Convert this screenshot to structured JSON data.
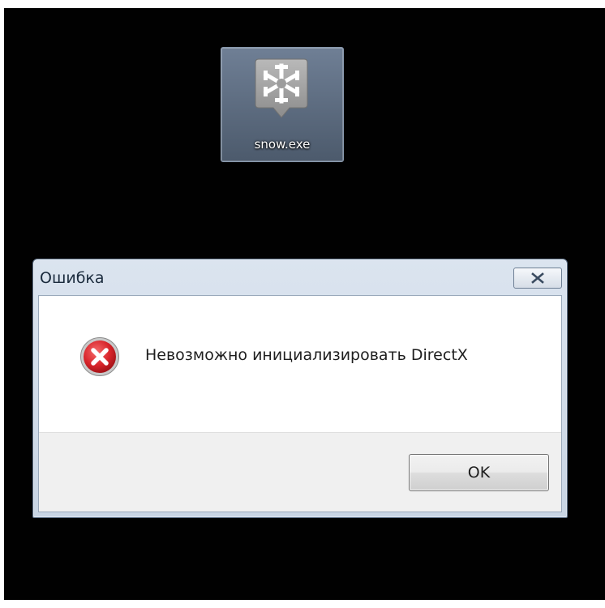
{
  "desktop": {
    "icon": {
      "label": "snow.exe",
      "icon_name": "snowflake-app-icon"
    }
  },
  "dialog": {
    "title": "Ошибка",
    "close_icon": "close-icon",
    "message": "Невозможно инициализировать DirectX",
    "status_icon": "error-icon",
    "ok_label": "OK"
  },
  "colors": {
    "desktop_background": "#010101",
    "error_red": "#d8242a",
    "title_bar": "#dbe4ef"
  }
}
